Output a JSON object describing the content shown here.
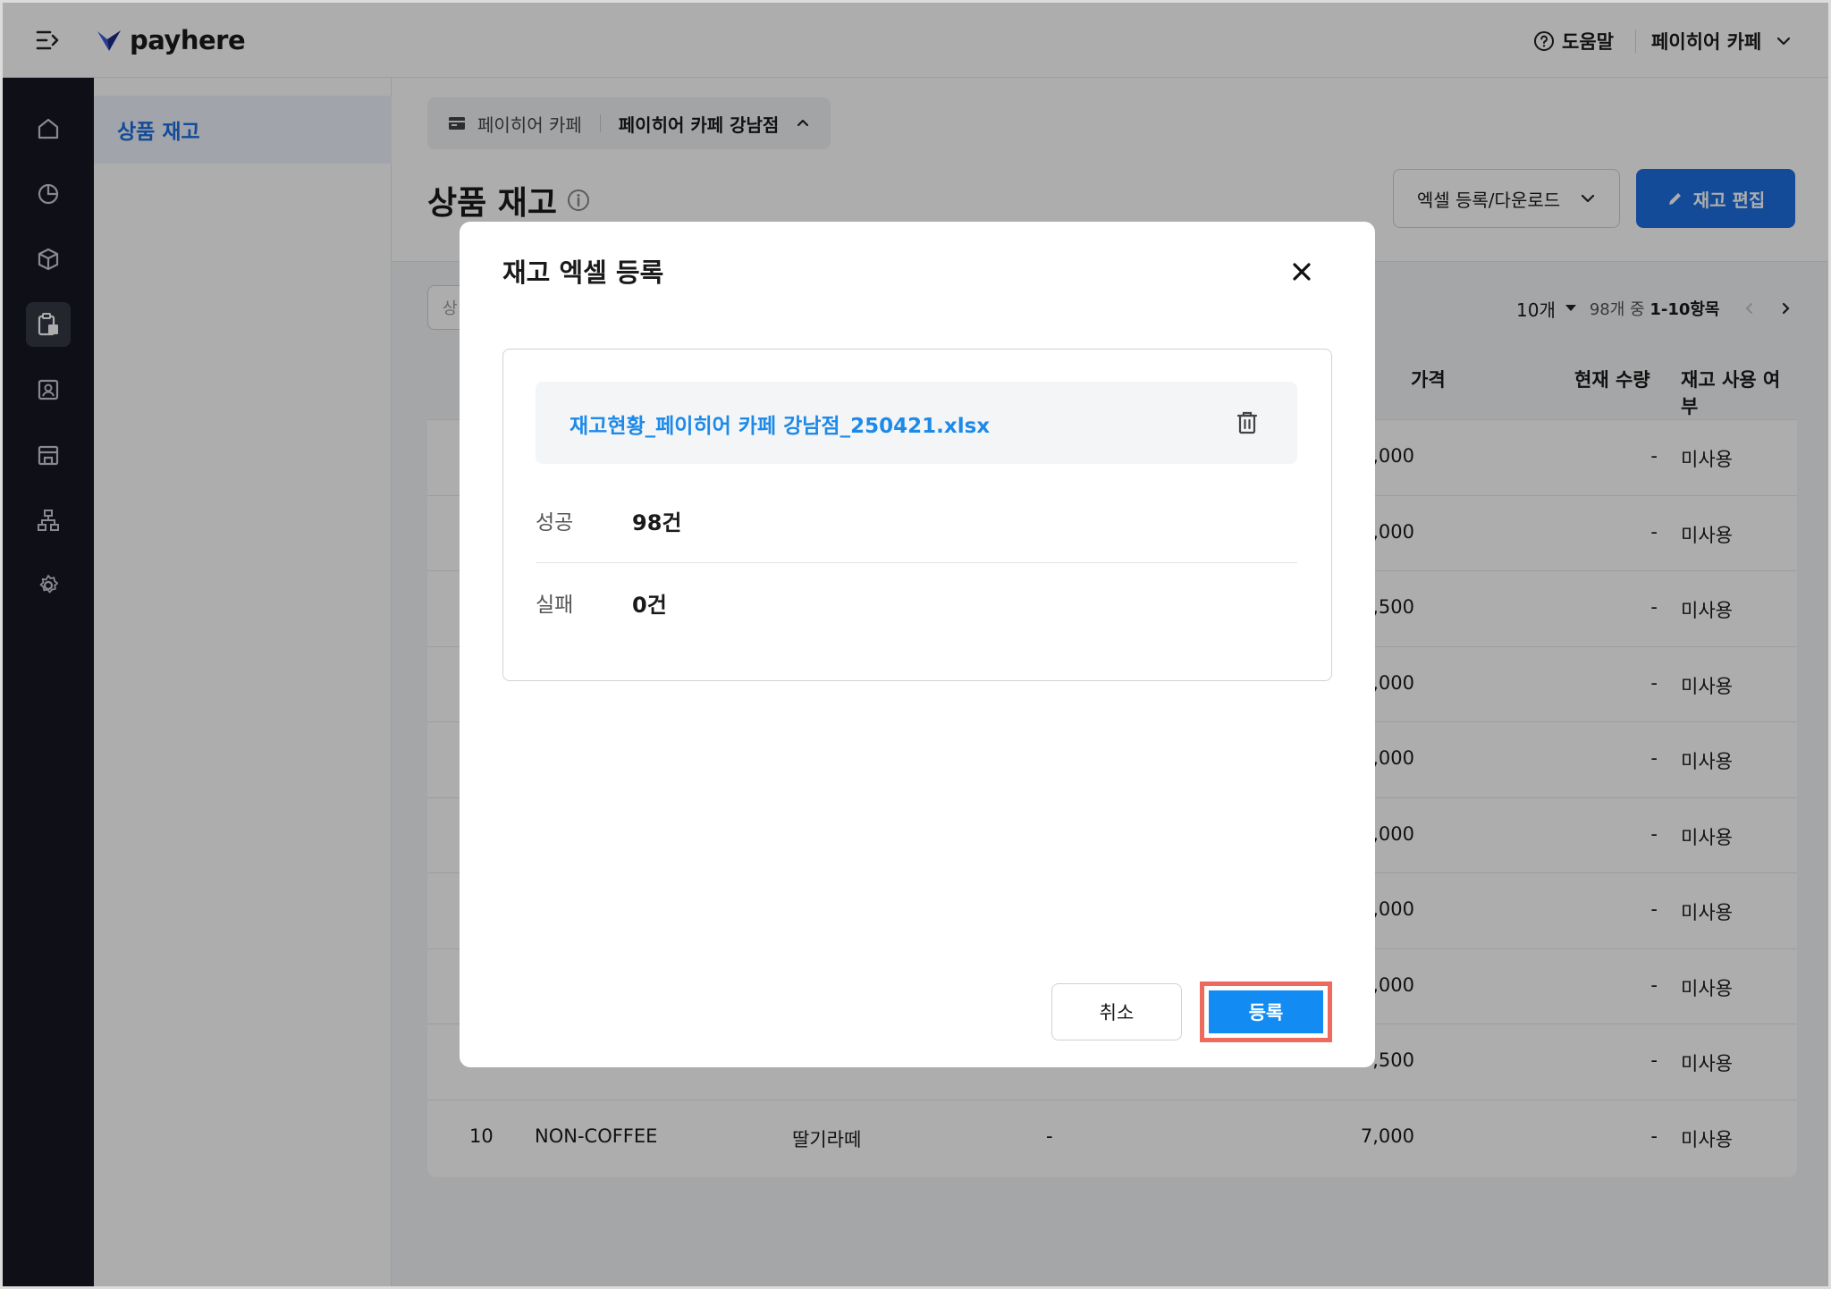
{
  "app": {
    "logo_text": "payhere",
    "help_label": "도움말",
    "store_menu_label": "페이히어 카페"
  },
  "subnav": {
    "active_item": "상품 재고"
  },
  "header": {
    "crumb_brand": "페이히어 카페",
    "crumb_store": "페이히어 카페 강남점",
    "page_title": "상품 재고",
    "excel_button": "엑셀 등록/다운로드",
    "edit_button": "재고 편집"
  },
  "toolbar": {
    "search_placeholder": "상",
    "page_size": "10개",
    "range_prefix": "98개 중 ",
    "range_value": "1-10항목"
  },
  "table": {
    "columns": [
      "가격",
      "현재 수량",
      "재고 사용 여부"
    ],
    "rows": [
      {
        "price": ",000",
        "qty": "-",
        "use": "미사용"
      },
      {
        "price": ",000",
        "qty": "-",
        "use": "미사용"
      },
      {
        "price": ",500",
        "qty": "-",
        "use": "미사용"
      },
      {
        "price": ",000",
        "qty": "-",
        "use": "미사용"
      },
      {
        "price": ",000",
        "qty": "-",
        "use": "미사용"
      },
      {
        "price": ",000",
        "qty": "-",
        "use": "미사용"
      },
      {
        "price": ",000",
        "qty": "-",
        "use": "미사용"
      },
      {
        "price": ",000",
        "qty": "-",
        "use": "미사용"
      },
      {
        "price": ",500",
        "qty": "-",
        "use": "미사용"
      },
      {
        "no": "10",
        "category": "NON-COFFEE",
        "name": "딸기라떼",
        "option": "-",
        "price": "7,000",
        "qty": "-",
        "use": "미사용"
      }
    ]
  },
  "modal": {
    "title": "재고 엑셀 등록",
    "file_name": "재고현황_페이히어 카페 강남점_250421.xlsx",
    "success_label": "성공",
    "success_value": "98건",
    "fail_label": "실패",
    "fail_value": "0건",
    "cancel_button": "취소",
    "register_button": "등록"
  },
  "colors": {
    "primary": "#1d6fe0",
    "register": "#128cf2",
    "highlight": "#ee6a5c",
    "rail": "#171922"
  }
}
